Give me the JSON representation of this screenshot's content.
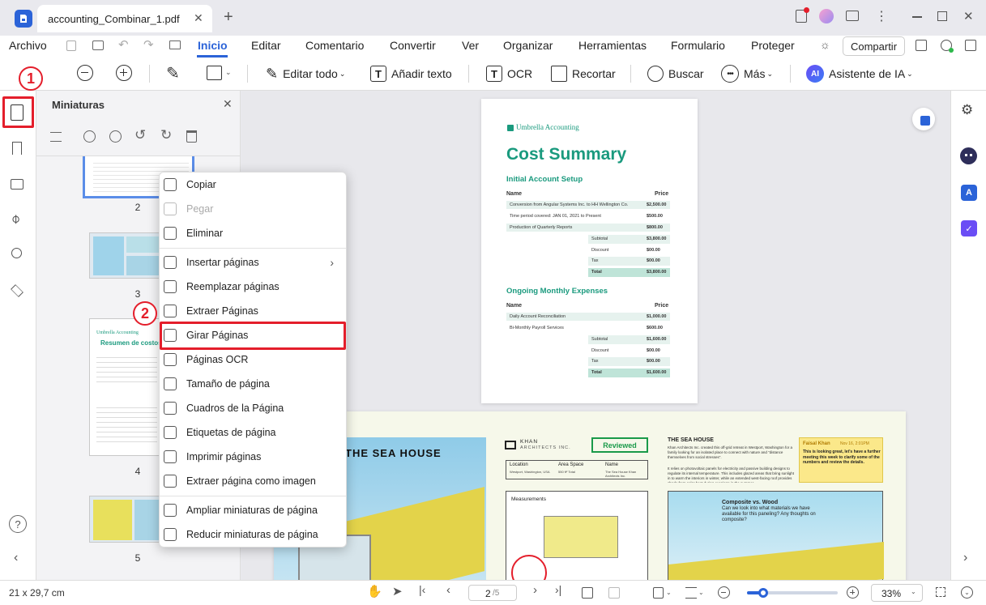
{
  "window": {
    "tab_title": "accounting_Combinar_1.pdf",
    "new_tab_label": "+"
  },
  "menubar": {
    "items": [
      "Archivo",
      "Inicio",
      "Editar",
      "Comentario",
      "Convertir",
      "Ver",
      "Organizar",
      "Herramientas",
      "Formulario",
      "Proteger"
    ],
    "active": "Inicio",
    "share_label": "Compartir"
  },
  "toolbar": {
    "edit_all": "Editar todo",
    "add_text": "Añadir texto",
    "ocr": "OCR",
    "crop": "Recortar",
    "search": "Buscar",
    "more": "Más",
    "ai_badge": "AI",
    "ai_assistant": "Asistente de IA"
  },
  "thumb_panel": {
    "title": "Miniaturas",
    "pages": [
      "2",
      "3",
      "4",
      "5"
    ]
  },
  "thumb_page4": {
    "brand": "Umbrella Accounting",
    "title": "Resumen de costos"
  },
  "context_menu": {
    "items": [
      {
        "label": "Copiar",
        "icon": "copy-icon",
        "disabled": false
      },
      {
        "label": "Pegar",
        "icon": "paste-icon",
        "disabled": true
      },
      {
        "label": "Eliminar",
        "icon": "trash-icon",
        "disabled": false
      },
      {
        "label": "Insertar páginas",
        "icon": "insert-pages-icon",
        "disabled": false,
        "submenu": true
      },
      {
        "label": "Reemplazar páginas",
        "icon": "replace-pages-icon",
        "disabled": false
      },
      {
        "label": "Extraer Páginas",
        "icon": "extract-pages-icon",
        "disabled": false
      },
      {
        "label": "Girar Páginas",
        "icon": "rotate-icon",
        "disabled": false
      },
      {
        "label": "Páginas OCR",
        "icon": "ocr-icon",
        "disabled": false
      },
      {
        "label": "Tamaño de página",
        "icon": "page-size-icon",
        "disabled": false
      },
      {
        "label": "Cuadros de la Página",
        "icon": "page-boxes-icon",
        "disabled": false
      },
      {
        "label": "Etiquetas de página",
        "icon": "page-label-icon",
        "disabled": false
      },
      {
        "label": "Imprimir páginas",
        "icon": "print-icon",
        "disabled": false
      },
      {
        "label": "Extraer página como imagen",
        "icon": "image-icon",
        "disabled": false
      },
      {
        "label": "Ampliar miniaturas de página",
        "icon": "zoom-in-icon",
        "disabled": false
      },
      {
        "label": "Reducir miniaturas de página",
        "icon": "zoom-out-icon",
        "disabled": false
      }
    ],
    "submenu_arrow": "›"
  },
  "annotations": {
    "step1": "1",
    "step2": "2"
  },
  "document": {
    "brand": "Umbrella Accounting",
    "title": "Cost Summary",
    "section1": "Initial Account Setup",
    "col_name": "Name",
    "col_price": "Price",
    "rows1": [
      {
        "name": "Conversion from Angular Systems Inc. to HH Wellington Co.",
        "price": "$2,500.00"
      },
      {
        "name": "Time period covered: JAN 01, 2021 to Present",
        "price": "$500.00"
      },
      {
        "name": "Production of Quarterly Reports",
        "price": "$800.00"
      }
    ],
    "totals1": [
      {
        "label": "Subtotal",
        "value": "$3,800.00"
      },
      {
        "label": "Discount",
        "value": "$00.00"
      },
      {
        "label": "Tax",
        "value": "$00.00"
      },
      {
        "label": "Total",
        "value": "$3,800.00"
      }
    ],
    "section2": "Ongoing Monthly Expenses",
    "rows2": [
      {
        "name": "Daily Account Reconciliation",
        "price": "$1,000.00"
      },
      {
        "name": "Bi-Monthly Payroll Services",
        "price": "$600.00"
      }
    ],
    "totals2": [
      {
        "label": "Subtotal",
        "value": "$1,600.00"
      },
      {
        "label": "Discount",
        "value": "$00.00"
      },
      {
        "label": "Tax",
        "value": "$00.00"
      },
      {
        "label": "Total",
        "value": "$1,600.00"
      }
    ]
  },
  "page2": {
    "sea_house_banner": "THE SEA HOUSE",
    "logo_line1": "KHAN",
    "logo_line2": "ARCHITECTS INC.",
    "reviewed": "Reviewed",
    "info_headers": [
      "Location",
      "Area Space",
      "Name"
    ],
    "info_values": [
      "Westport, Washington, USA",
      "550 ft² Total",
      "The Sea House Khan Architects Inc."
    ],
    "measurements": "Measurements",
    "heading": "THE SEA HOUSE",
    "body_text": "Khan Architects Inc. created this off-grid retreat in Westport, Washington for a family looking for an isolated place to connect with nature and \"distance themselves from social stresses\".",
    "body_text2": "It relies on photovoltaic panels for electricity and passive building designs to regulate its internal temperature. This includes glazed areas that bring sunlight in to warm the interiors in winter, while an extended west-facing roof provides shade from solar heat during evenings in the summer.",
    "note_author": "Faisal Khan",
    "note_date": "Nov 16, 2:01PM",
    "note_text": "This is looking great, let's have a further meeting this week to clarify some of the numbers and review the details.",
    "composite_title": "Composite vs. Wood",
    "composite_text": "Can we look into what materials we have available for this paneling? Any thoughts on composite?"
  },
  "statusbar": {
    "page_size": "21 x 29,7 cm",
    "current_page": "2",
    "total_pages": "/5",
    "zoom": "33%",
    "zoom_level": 0.18
  },
  "colors": {
    "accent": "#2b63d8",
    "highlight": "#e41e2b",
    "teal": "#1a9a7e"
  }
}
